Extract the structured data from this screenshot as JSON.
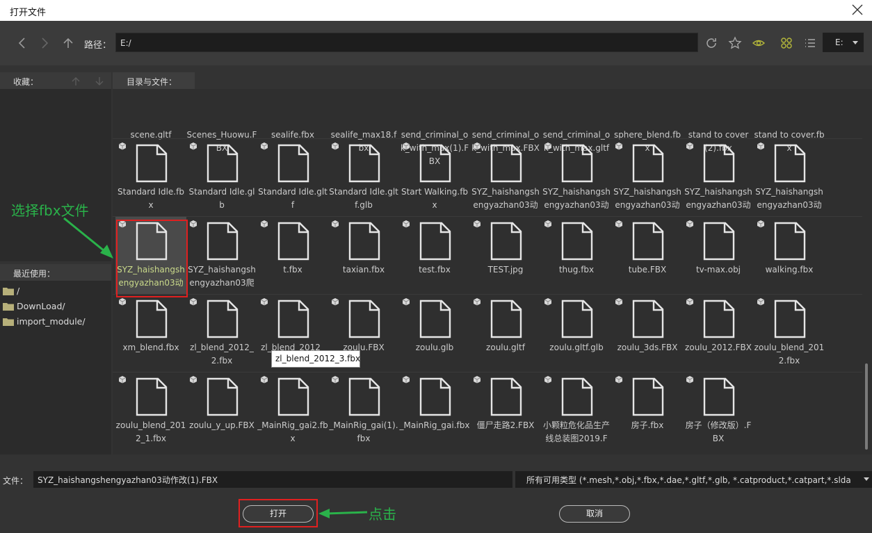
{
  "window": {
    "title": "打开文件"
  },
  "toolbar": {
    "path_label": "路径：",
    "path_value": "E:/",
    "drive_value": "E:"
  },
  "favorites": {
    "header": "收藏："
  },
  "recent": {
    "header": "最近使用：",
    "items": [
      "/",
      "DownLoad/",
      "import_module/"
    ]
  },
  "main": {
    "header": "目录与文件：",
    "rows": [
      [
        "scene.gltf",
        "Scenes_Huowu.FBX",
        "sealife.fbx",
        "sealife_max18.fbx",
        "send_criminal_ok_with_max(1).FBX",
        "send_criminal_ok_with_max.FBX",
        "send_criminal_ok_with_max.gltf",
        "sphere_blend.fbx",
        "stand to cover (2).fbx",
        "stand to cover.fbx"
      ],
      [
        "Standard Idle.fbx",
        "Standard Idle.glb",
        "Standard Idle.gltf",
        "Standard Idle.gltf.glb",
        "Start Walking.fbx",
        "SYZ_haishangshengyazhan03动",
        "SYZ_haishangshengyazhan03动",
        "SYZ_haishangshengyazhan03动",
        "SYZ_haishangshengyazhan03动",
        "SYZ_haishangshengyazhan03动"
      ],
      [
        "SYZ_haishangshengyazhan03动",
        "SYZ_haishangshengyazhan03爬",
        "t.fbx",
        "taxian.fbx",
        "test.fbx",
        "TEST.jpg",
        "thug.fbx",
        "tube.FBX",
        "tv-max.obj",
        "walking.fbx"
      ],
      [
        "xm_blend.fbx",
        "zl_blend_2012_2.fbx",
        "zl_blend_2012_3.fbx",
        "zoulu.FBX",
        "zoulu.glb",
        "zoulu.gltf",
        "zoulu.gltf.glb",
        "zoulu_3ds.FBX",
        "zoulu_2012.FBX",
        "zoulu_blend_2012.fbx"
      ],
      [
        "zoulu_blend_2012_1.fbx",
        "zoulu_y_up.FBX",
        "_MainRig_gai2.fbx",
        "_MainRig_gai(1).fbx",
        "_MainRig_gai.fbx",
        "僵尸走路2.FBX",
        "小颗粒危化品生产线总装图2019.F",
        "房子.fbx",
        "房子（修改版）.FBX"
      ]
    ],
    "selected": "SYZ_haishangshengyazhan03动",
    "tooltip": "zl_blend_2012_3.fbx"
  },
  "bottom": {
    "file_label": "文件：",
    "file_value": "SYZ_haishangshengyazhan03动作改(1).FBX",
    "type_value": "所有可用类型 (*.mesh,*.obj,*.fbx,*.dae,*.gltf,*.glb, *.catproduct,*.catpart,*.slda",
    "open_label": "打开",
    "cancel_label": "取消"
  },
  "annotations": {
    "select_text": "选择fbx文件",
    "click_text": "点击",
    "arrow_color": "#2ab24a",
    "box_color": "#e02020"
  }
}
